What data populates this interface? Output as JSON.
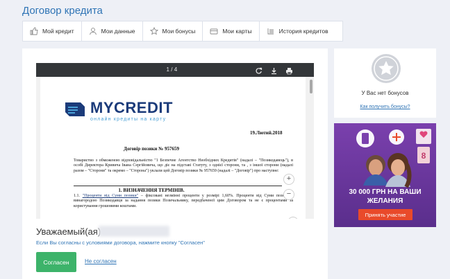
{
  "page": {
    "title": "Договор кредита"
  },
  "nav": {
    "items": [
      {
        "label": "Мой кредит",
        "icon": "thumbs-up-icon"
      },
      {
        "label": "Мои данные",
        "icon": "user-icon"
      },
      {
        "label": "Мои бонусы",
        "icon": "star-icon"
      },
      {
        "label": "Мои карты",
        "icon": "card-icon"
      },
      {
        "label": "История кредитов",
        "icon": "list-icon"
      }
    ]
  },
  "viewer": {
    "current_page": "1",
    "page_separator": "/",
    "total_pages": "4"
  },
  "document": {
    "logo_name": "MYCREDIT",
    "logo_tagline": "онлайн кредиты на карту",
    "date": "19.Лютий.2018",
    "title": "Договір позики № 957659",
    "intro": "Товариство з обмеженою відповідальністю \"1 Безпечне Агентство Необхідних Кредитів\" (надалі – \"Позикодавець\"), в особі Директора Кривича Івана Сергійовича, що діє на підставі Статуту, з однієї сторони, та                                   , з іншої сторони (надалі разом – \"Сторони\" та окремо – \"Сторона\") уклали цей Договір позики № 957659 (надалі – \"Договір\") про наступне:",
    "section_1": "1. ВИЗНАЧЕННЯ ТЕРМІНІВ.",
    "clause_1_1_num": "1.1.",
    "clause_1_1_term": "\"Проценти від Суми позики\"",
    "clause_1_1_text": "– фіксовані незмінні проценти у розмірі 1,60%. Проценти від Суми позики є винагородою Позикодавця за надання позики Позичальнику, передбаченої цим Договором та не є процентами за користування грошовими коштами."
  },
  "consent": {
    "greeting": "Уважаемый(ая)",
    "instruction": "Если Вы согласны с условиями договора, нажмите кнопку \"Согласен\"",
    "agree_label": "Согласен",
    "disagree_label": "Не согласен"
  },
  "bonus": {
    "empty_text": "У Вас нет бонусов",
    "link_text": "Как получить бонусы?"
  },
  "promo": {
    "amount_line1": "30 000 ГРН НА ВАШИ",
    "amount_line2": "ЖЕЛАНИЯ",
    "button_label": "Принять участие"
  },
  "colors": {
    "accent": "#2f74b5",
    "agree_button": "#3db36a",
    "promo_background": "#6f3aa0",
    "promo_button": "#e94a2a",
    "viewer_toolbar": "#333639"
  }
}
